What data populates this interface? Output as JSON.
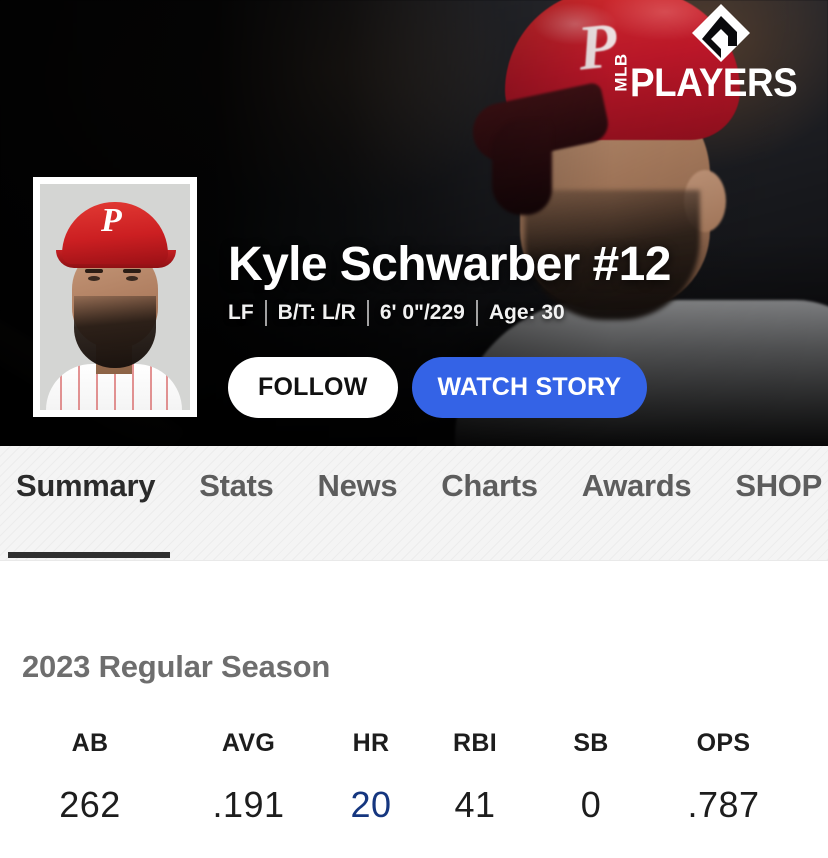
{
  "brand": {
    "logo_mlb": "MLB",
    "logo_players": "PLAYERS",
    "logo_icon": "mlb-diamond-icon"
  },
  "hero": {
    "player_name": "Kyle Schwarber #12",
    "bio": {
      "position": "LF",
      "bats_throws": "B/T: L/R",
      "height_weight": "6' 0\"/229",
      "age": "Age: 30"
    },
    "headshot_alt": "Kyle Schwarber headshot",
    "buttons": {
      "follow": "FOLLOW",
      "watch_story": "WATCH STORY"
    },
    "colors": {
      "watch_story_bg": "#3463e6",
      "follow_bg": "#ffffff",
      "hero_bg": "#0a0a0c"
    }
  },
  "nav": {
    "tabs": [
      {
        "label": "Summary",
        "active": true
      },
      {
        "label": "Stats",
        "active": false
      },
      {
        "label": "News",
        "active": false
      },
      {
        "label": "Charts",
        "active": false
      },
      {
        "label": "Awards",
        "active": false
      },
      {
        "label": "SHOP",
        "active": false
      }
    ],
    "active_underline_color": "#2e2e2e"
  },
  "stats": {
    "season_title": "2023 Regular Season",
    "highlight_color": "#15367f",
    "columns": [
      {
        "label": "AB",
        "value": "262",
        "highlight": false
      },
      {
        "label": "AVG",
        "value": ".191",
        "highlight": false
      },
      {
        "label": "HR",
        "value": "20",
        "highlight": true
      },
      {
        "label": "RBI",
        "value": "41",
        "highlight": false
      },
      {
        "label": "SB",
        "value": "0",
        "highlight": false
      },
      {
        "label": "OPS",
        "value": ".787",
        "highlight": false
      }
    ]
  }
}
